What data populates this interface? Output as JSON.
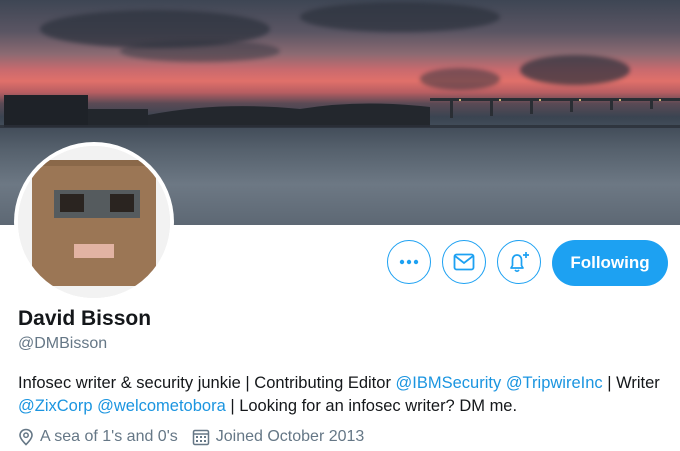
{
  "profile": {
    "name": "David Bisson",
    "handle": "@DMBisson",
    "bio": {
      "text1": "Infosec writer & security junkie | Contributing Editor ",
      "mention1": "@IBMSecurity",
      "sep1": " ",
      "mention2": "@TripwireInc",
      "text2": " | Writer ",
      "mention3": "@ZixCorp",
      "sep2": " ",
      "mention4": "@welcometobora",
      "text3": " | Looking for an infosec writer? DM me."
    },
    "location": "A sea of 1's and 0's",
    "joined": "Joined October 2013"
  },
  "actions": {
    "follow_label": "Following"
  },
  "icons": {
    "more": "more-icon",
    "message": "envelope-icon",
    "notifications": "bell-plus-icon",
    "location": "location-pin-icon",
    "calendar": "calendar-icon"
  },
  "colors": {
    "accent": "#1da1f2",
    "link": "#1b95e0",
    "secondary_text": "#657786"
  }
}
